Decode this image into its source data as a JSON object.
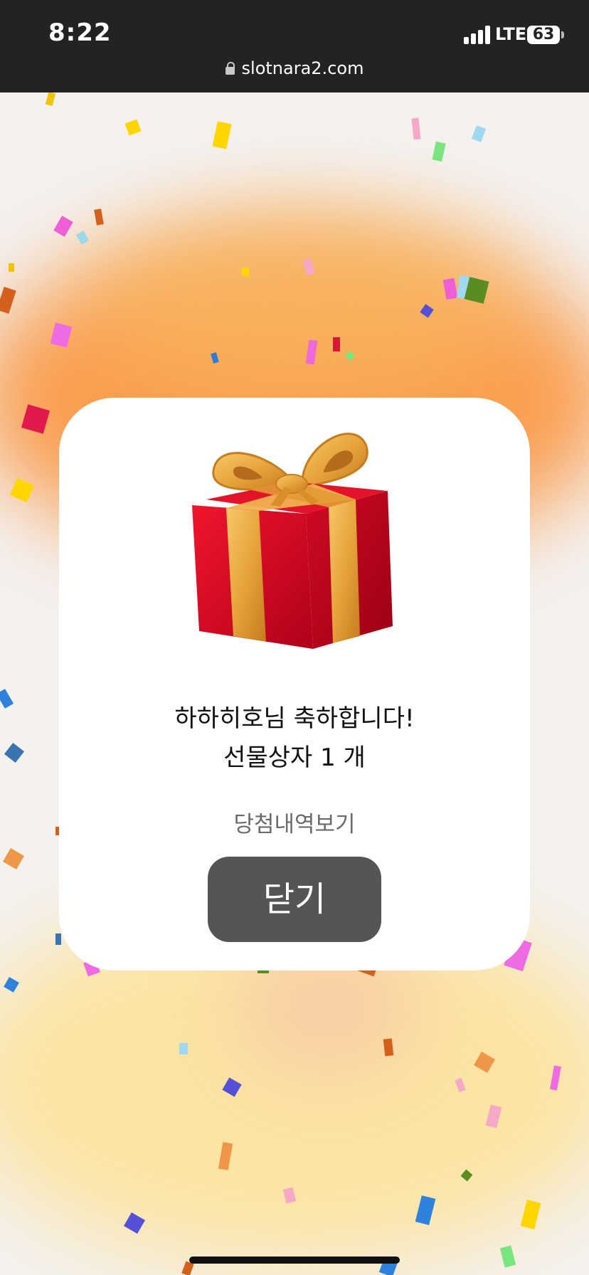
{
  "status_bar": {
    "time": "8:22",
    "network": "LTE",
    "battery_level": "63"
  },
  "browser": {
    "url": "slotnara2.com"
  },
  "dialog": {
    "congrats_text": "하하히호님 축하합니다!",
    "prize_text": "선물상자 1 개",
    "history_link": "당첨내역보기",
    "close_label": "닫기"
  },
  "colors": {
    "status_bar_bg": "#232323",
    "button_bg": "#565556",
    "glow_orange": "#f98a2c",
    "glow_yellow": "#ffd867",
    "gift_red": "#d8061e",
    "ribbon_gold": "#e7a43c"
  },
  "icons": {
    "lock": "lock-icon",
    "signal": "signal-icon",
    "battery": "battery-icon",
    "gift": "gift-box-icon"
  }
}
